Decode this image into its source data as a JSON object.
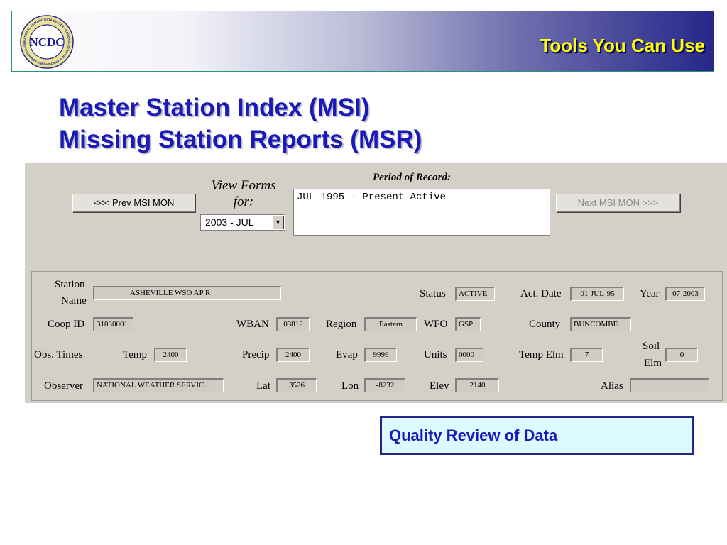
{
  "header": {
    "logo_text": "NCDC",
    "logo_ring_text": "NATIONAL CLIMATIC DATA CENTER • NATIONAL OCEANIC & ATMOSPHERIC ADMINISTRATION",
    "title": "Tools You Can Use"
  },
  "slide": {
    "title_line1": "Master Station Index (MSI)",
    "title_line2": "Missing Station Reports (MSR)"
  },
  "form": {
    "prev_button": "<<< Prev MSI MON",
    "next_button": "Next MSI MON >>>",
    "view_forms_line1": "View Forms",
    "view_forms_line2": "for:",
    "selected_month": "2003 - JUL",
    "period_label": "Period of Record:",
    "period_value": "JUL 1995 - Present Active"
  },
  "station": {
    "labels": {
      "station_name_1": "Station",
      "station_name_2": "Name",
      "status": "Status",
      "act_date": "Act. Date",
      "year": "Year",
      "coop_id": "Coop ID",
      "wban": "WBAN",
      "region": "Region",
      "wfo": "WFO",
      "county": "County",
      "obs_times": "Obs. Times",
      "temp": "Temp",
      "precip": "Precip",
      "evap": "Evap",
      "units": "Units",
      "temp_elm": "Temp Elm",
      "soil_1": "Soil",
      "soil_2": "Elm",
      "observer": "Observer",
      "lat": "Lat",
      "lon": "Lon",
      "elev": "Elev",
      "alias": "Alias"
    },
    "values": {
      "station_name": "ASHEVILLE WSO AP       R",
      "status": "ACTIVE",
      "act_date": "01-JUL-95",
      "year": "07-2003",
      "coop_id": "31030001",
      "wban": "03812",
      "region": "Eastern",
      "wfo": "GSP",
      "county": "BUNCOMBE",
      "temp": "2400",
      "precip": "2400",
      "evap": "9999",
      "units": "0000",
      "temp_elm": "7",
      "soil_elm": "0",
      "observer": "NATIONAL WEATHER SERVIC",
      "lat": "3526",
      "lon": "-8232",
      "elev": "2140",
      "alias": ""
    }
  },
  "callout": {
    "text": "Quality Review of Data"
  }
}
